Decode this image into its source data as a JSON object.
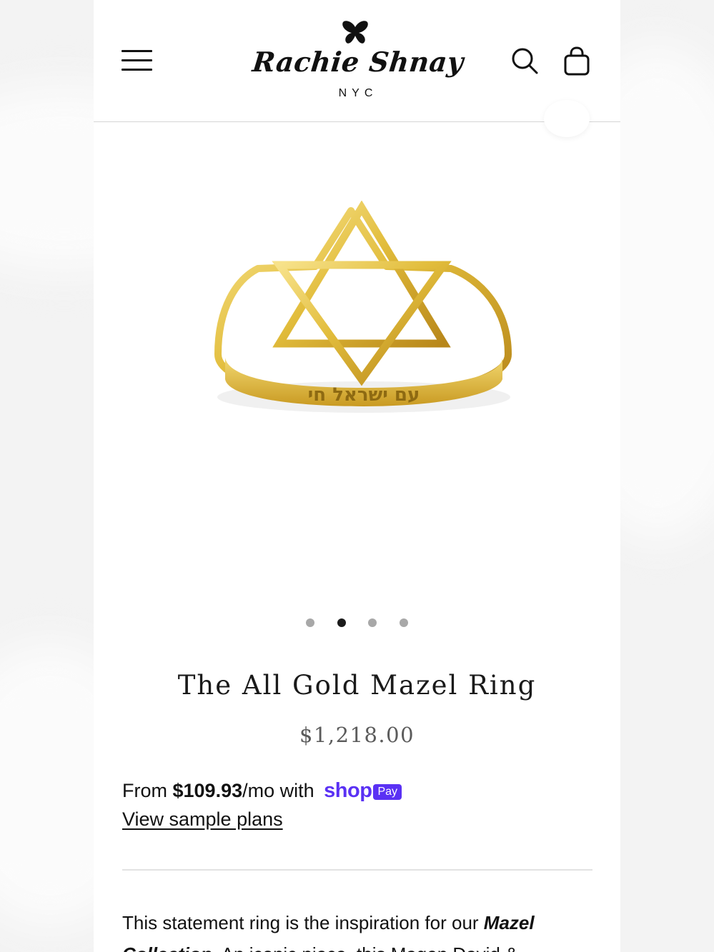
{
  "brand": {
    "name": "Rachie Shnay",
    "city": "NYC"
  },
  "header": {
    "menu_icon": "hamburger-icon",
    "search_icon": "search-icon",
    "cart_icon": "shopping-bag-icon"
  },
  "gallery": {
    "slide_count": 4,
    "active_index": 1,
    "ring_engraving": "עם ישראל חי"
  },
  "product": {
    "title": "The All Gold Mazel Ring",
    "price": "$1,218.00"
  },
  "installments": {
    "prefix": "From ",
    "amount": "$109.93",
    "suffix": "/mo with",
    "shop_word": "shop",
    "pay_word": "Pay",
    "link_label": "View sample plans",
    "accent": "#5a31f4"
  },
  "description": {
    "text_start": "This statement ring is the inspiration for our ",
    "collection_name": "Mazel Collection",
    "text_rest": ". An iconic piece, this Magen David &"
  }
}
